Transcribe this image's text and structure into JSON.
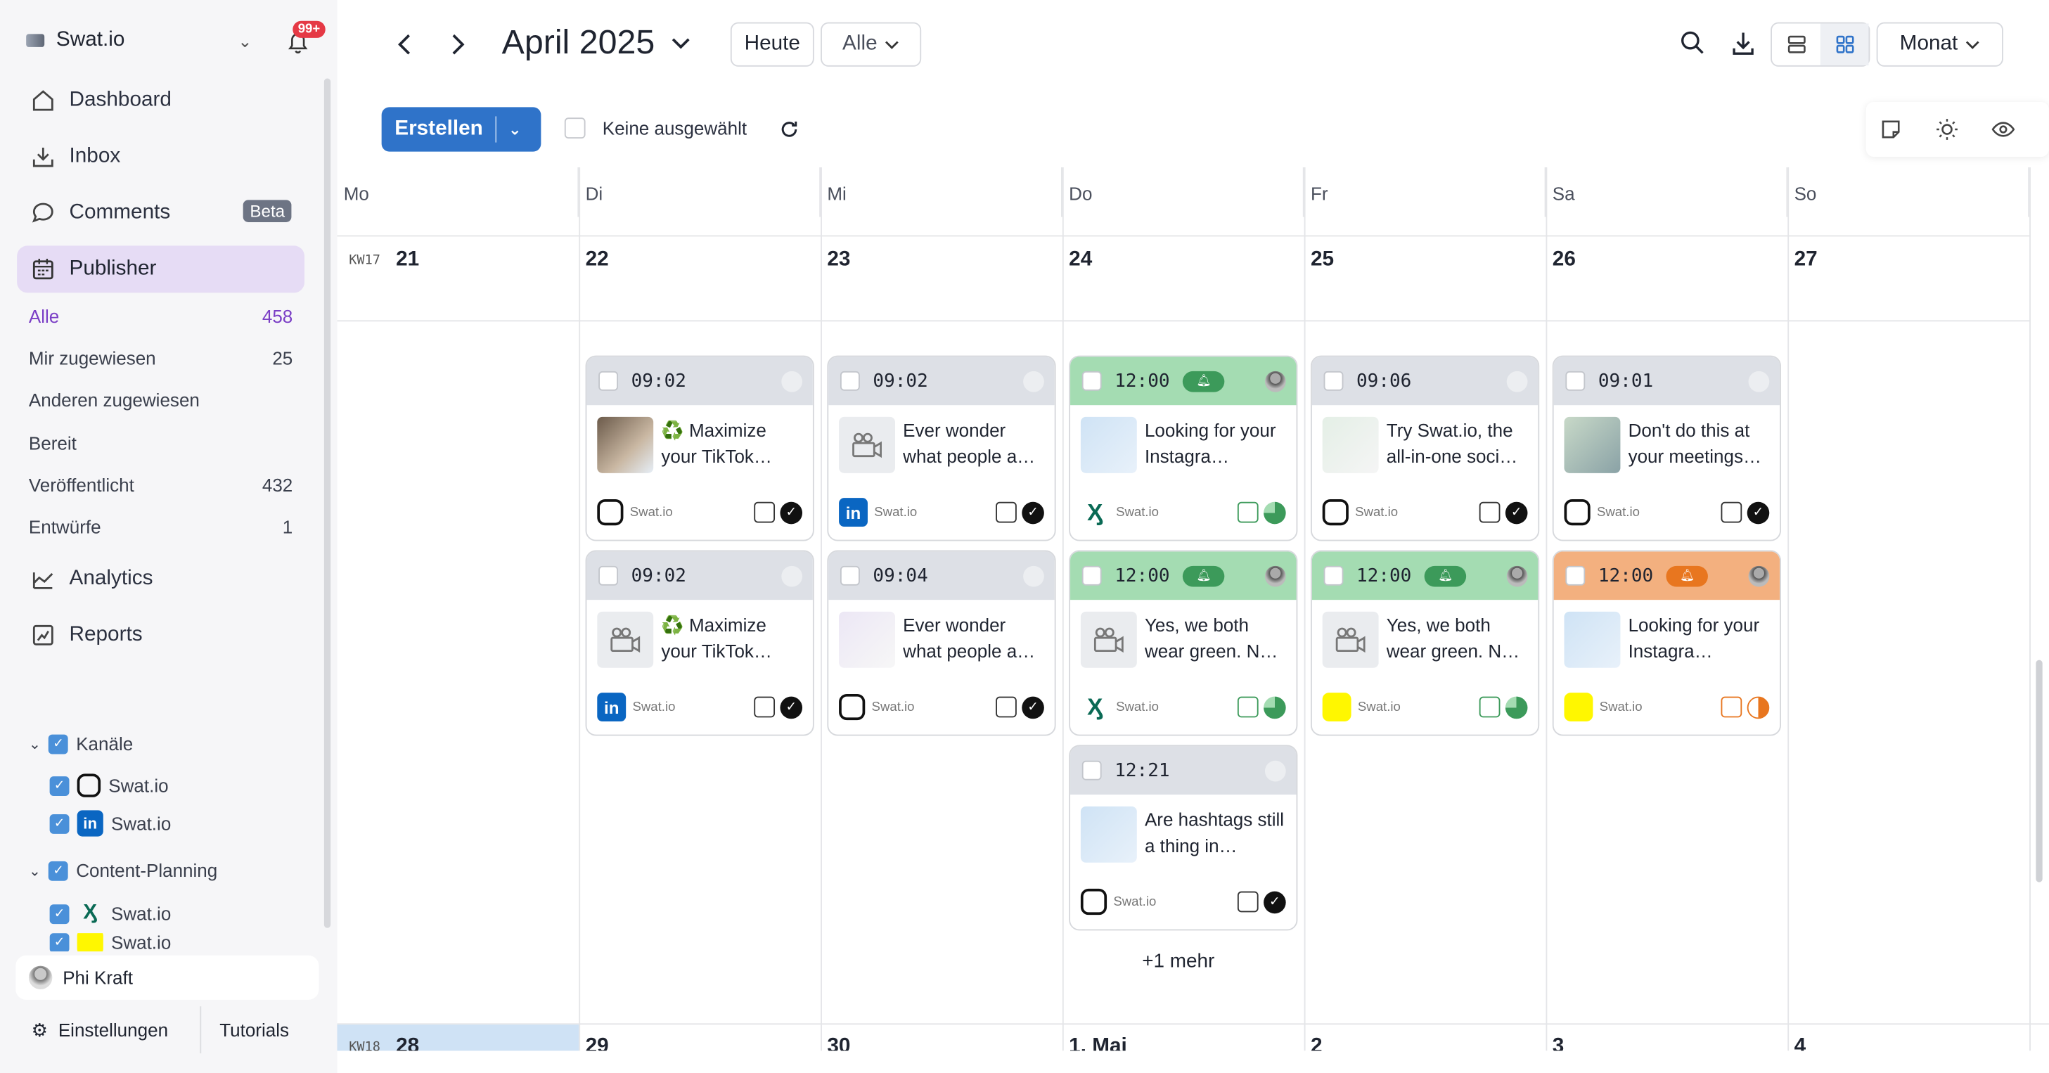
{
  "app": {
    "name": "Swat.io",
    "notif_badge": "99+"
  },
  "nav": {
    "dashboard": "Dashboard",
    "inbox": "Inbox",
    "comments": "Comments",
    "beta": "Beta",
    "publisher": "Publisher",
    "analytics": "Analytics",
    "reports": "Reports"
  },
  "filters": [
    {
      "label": "Alle",
      "count": "458"
    },
    {
      "label": "Mir zugewiesen",
      "count": "25"
    },
    {
      "label": "Anderen zugewiesen",
      "count": ""
    },
    {
      "label": "Bereit",
      "count": ""
    },
    {
      "label": "Veröffentlicht",
      "count": "432"
    },
    {
      "label": "Entwürfe",
      "count": "1"
    }
  ],
  "tree": {
    "kanaele": "Kanäle",
    "ch1": "Swat.io",
    "ch2": "Swat.io",
    "content_planning": "Content-Planning",
    "cp1": "Swat.io",
    "cp2": "Swat.io"
  },
  "user": {
    "name": "Phi Kraft"
  },
  "footer": {
    "settings": "Einstellungen",
    "tutorials": "Tutorials"
  },
  "header": {
    "month": "April 2025",
    "today": "Heute",
    "filter": "Alle",
    "view": "Monat"
  },
  "toolbar": {
    "create": "Erstellen",
    "selection": "Keine ausgewählt"
  },
  "calendar": {
    "days": [
      "Mo",
      "Di",
      "Mi",
      "Do",
      "Fr",
      "Sa",
      "So"
    ],
    "week_label": "KW17",
    "dates": [
      "21",
      "22",
      "23",
      "24",
      "25",
      "26",
      "27"
    ],
    "next_week_label": "KW18",
    "next_dates": [
      "28",
      "29",
      "30",
      "1. Mai",
      "2",
      "3",
      "4"
    ],
    "more": "+1 mehr"
  },
  "cards": [
    {
      "time": "09:02",
      "text": "♻️ Maximize your TikTok…",
      "account": "Swat.io",
      "network": "instagram"
    },
    {
      "time": "09:02",
      "text": "♻️ Maximize your TikTok…",
      "account": "Swat.io",
      "network": "linkedin"
    },
    {
      "time": "09:02",
      "text": "Ever wonder what people a…",
      "account": "Swat.io",
      "network": "linkedin"
    },
    {
      "time": "09:04",
      "text": "Ever wonder what people a…",
      "account": "Swat.io",
      "network": "instagram"
    },
    {
      "time": "12:00",
      "text": "Looking for your Instagra…",
      "account": "Swat.io",
      "network": "xing"
    },
    {
      "time": "12:00",
      "text": "Yes, we both wear green. N…",
      "account": "Swat.io",
      "network": "xing"
    },
    {
      "time": "12:21",
      "text": "Are hashtags still a thing in…",
      "account": "Swat.io",
      "network": "instagram"
    },
    {
      "time": "09:06",
      "text": "Try Swat.io, the all-in-one soci…",
      "account": "Swat.io",
      "network": "instagram"
    },
    {
      "time": "12:00",
      "text": "Yes, we both wear green. N…",
      "account": "Swat.io",
      "network": "snapchat"
    },
    {
      "time": "09:01",
      "text": "Don't do this at your meetings…",
      "account": "Swat.io",
      "network": "instagram"
    },
    {
      "time": "12:00",
      "text": "Looking for your Instagra…",
      "account": "Swat.io",
      "network": "snapchat"
    }
  ],
  "colors": {
    "accent": "#2f73c9",
    "publisher_bg": "#e6dcf5",
    "scheduled": "#a4dcb2",
    "warning": "#f3b07f"
  }
}
